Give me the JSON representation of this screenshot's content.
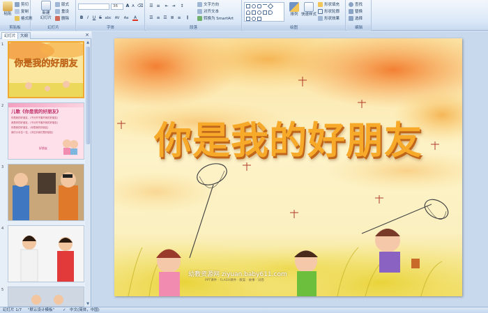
{
  "ribbon": {
    "groups": {
      "clipboard": "剪贴板",
      "slides": "幻灯片",
      "font": "字体",
      "paragraph": "段落",
      "drawing": "绘图",
      "editing": "编辑"
    },
    "clipboard": {
      "paste": "粘贴",
      "cut": "剪切",
      "copy": "复制",
      "format_painter": "格式刷"
    },
    "slides": {
      "new_slide": "新建",
      "new_slide_line2": "幻灯片",
      "layout": "版式",
      "reset": "重设",
      "delete": "删除"
    },
    "font": {
      "size": "36",
      "bold": "B",
      "italic": "I",
      "underline": "U",
      "strike": "S",
      "shadow": "abc",
      "spacing": "AV",
      "case": "Aa",
      "color": "A",
      "grow": "A",
      "shrink": "A"
    },
    "paragraph": {
      "text_direction": "文字方向",
      "align_text": "对齐文本",
      "smartart": "转换为 SmartArt"
    },
    "drawing": {
      "arrange": "排列",
      "quick_styles": "快速样式",
      "shape_fill": "形状填充",
      "shape_outline": "形状轮廓",
      "shape_effects": "形状效果"
    },
    "editing": {
      "find": "查找",
      "replace": "替换",
      "select": "选择"
    }
  },
  "panel": {
    "tabs": [
      "幻灯片",
      "大纲"
    ],
    "close": "×",
    "slide_numbers": [
      "1",
      "2",
      "3",
      "4",
      "5"
    ],
    "thumb2": {
      "title": "儿歌《你是我的好朋友》",
      "lines": [
        "你是我的好朋友，(不分开不离开我的好朋友)",
        "我是你的好朋友，(不分开不离开我的好朋友)",
        "你是我的好朋友，(你是我的好朋友)",
        "我们小手拉一拉，(手拉手我们是好朋友)"
      ],
      "badge": "好朋友"
    }
  },
  "slide": {
    "title": "你是我的好朋友",
    "watermark": "幼教资源网 ziyuan.baby611.com",
    "watermark_sub": "PPT课件 · FLASH课件 · 教案 · 故事 · 试卷"
  },
  "status": {
    "slide_info": "幻灯片 1/7",
    "theme": "\"默认设计模板\"",
    "language": "中文(简体，中国)"
  },
  "colors": {
    "accent": "#f0a830",
    "ribbon_blue": "#1e395b",
    "title_orange": "#f7a92a"
  }
}
